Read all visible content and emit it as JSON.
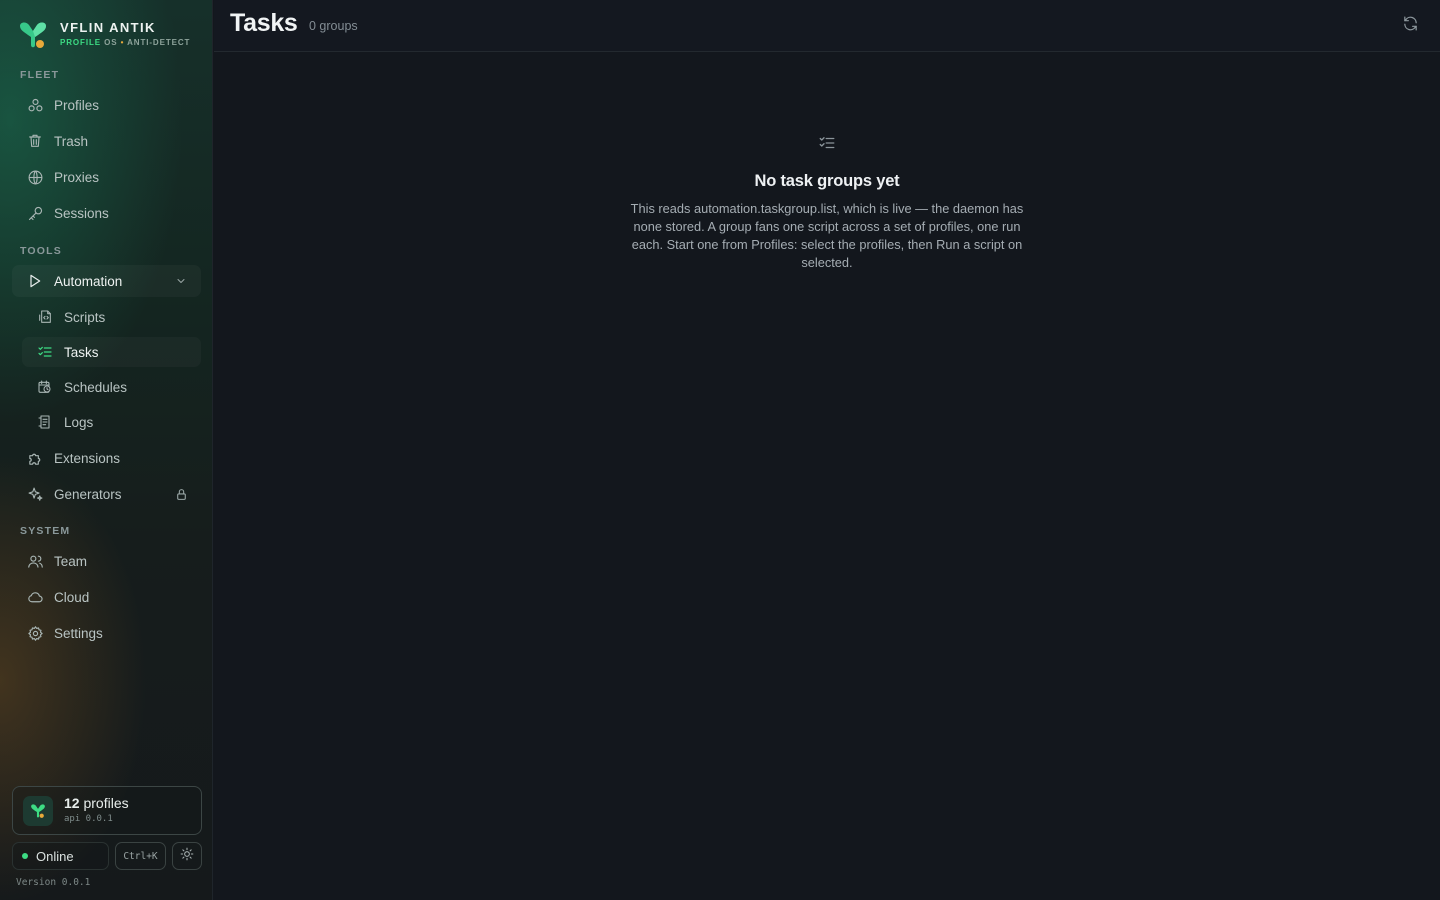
{
  "brand": {
    "name": "VFLIN ANTIK",
    "tag_highlight": "PROFILE",
    "tag_rest": "OS",
    "tag_dot": "•",
    "tag_end": "ANTI-DETECT"
  },
  "sidebar": {
    "sections": [
      {
        "label": "FLEET"
      },
      {
        "label": "TOOLS"
      },
      {
        "label": "SYSTEM"
      }
    ],
    "fleet_items": [
      {
        "label": "Profiles",
        "icon": "profiles-icon"
      },
      {
        "label": "Trash",
        "icon": "trash-icon"
      },
      {
        "label": "Proxies",
        "icon": "globe-icon"
      },
      {
        "label": "Sessions",
        "icon": "key-icon"
      }
    ],
    "automation": {
      "label": "Automation",
      "icon": "play-icon",
      "expanded": true
    },
    "automation_items": [
      {
        "label": "Scripts",
        "icon": "script-icon"
      },
      {
        "label": "Tasks",
        "icon": "checklist-icon",
        "active": true
      },
      {
        "label": "Schedules",
        "icon": "calendar-clock-icon"
      },
      {
        "label": "Logs",
        "icon": "logs-icon"
      }
    ],
    "tools_items": [
      {
        "label": "Extensions",
        "icon": "puzzle-icon"
      },
      {
        "label": "Generators",
        "icon": "sparkles-icon",
        "locked": true
      }
    ],
    "system_items": [
      {
        "label": "Team",
        "icon": "users-icon"
      },
      {
        "label": "Cloud",
        "icon": "cloud-icon"
      },
      {
        "label": "Settings",
        "icon": "gear-icon"
      }
    ]
  },
  "footer": {
    "profile_count": "12",
    "profile_word": "profiles",
    "api": "api 0.0.1",
    "status": "Online",
    "shortcut": "Ctrl+K",
    "version": "Version 0.0.1"
  },
  "header": {
    "title": "Tasks",
    "count": "0 groups"
  },
  "empty": {
    "title": "No task groups yet",
    "description": "This reads automation.taskgroup.list, which is live — the daemon has none stored. A group fans one script across a set of profiles, one run each. Start one from Profiles: select the profiles, then Run a script on selected."
  },
  "colors": {
    "accent": "#3ddc84",
    "background": "#13171d",
    "brand_secondary": "#e8a93a"
  }
}
